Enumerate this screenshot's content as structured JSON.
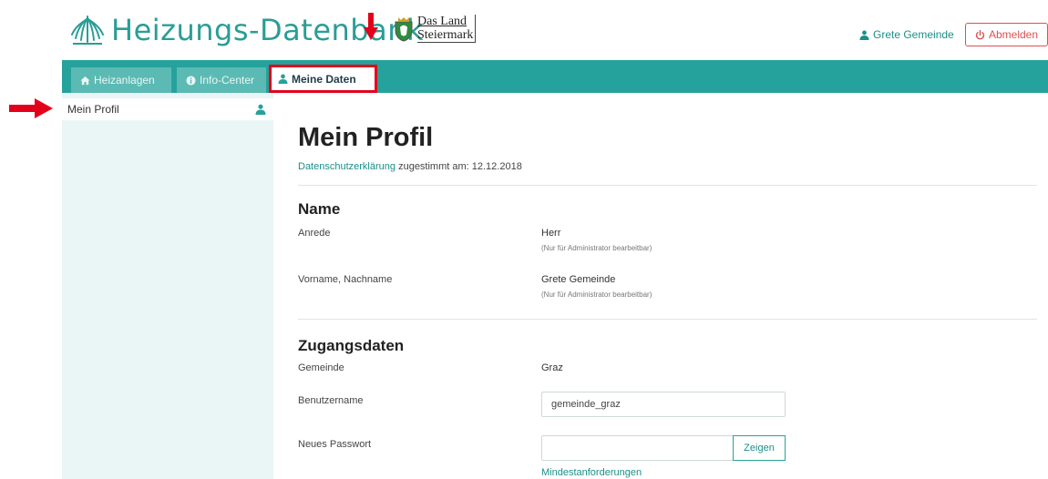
{
  "header": {
    "brand": "Heizungs-Datenbank",
    "partner_line1": "Das Land",
    "partner_line2": "Steiermark",
    "user_name": "Grete Gemeinde",
    "logout_label": "Abmelden"
  },
  "nav": {
    "tabs": [
      {
        "label": "Heizanlagen",
        "icon": "home-icon"
      },
      {
        "label": "Info-Center",
        "icon": "info-icon"
      },
      {
        "label": "Meine Daten",
        "icon": "user-icon",
        "active": true
      }
    ]
  },
  "sidebar": {
    "items": [
      {
        "label": "Mein Profil",
        "icon": "user-icon"
      }
    ]
  },
  "profile": {
    "title": "Mein Profil",
    "privacy_link": "Datenschutzerklärung",
    "privacy_text": "zugestimmt am: 12.12.2018",
    "section_name": "Name",
    "salutation_label": "Anrede",
    "salutation_value": "Herr",
    "salutation_note": "(Nur für Administrator bearbeitbar)",
    "fullname_label": "Vorname, Nachname",
    "fullname_value": "Grete Gemeinde",
    "fullname_note": "(Nur für Administrator bearbeitbar)",
    "section_access": "Zugangsdaten",
    "municipality_label": "Gemeinde",
    "municipality_value": "Graz",
    "username_label": "Benutzername",
    "username_value": "gemeinde_graz",
    "password_label": "Neues Passwort",
    "password_value": "",
    "show_button": "Zeigen",
    "requirements_link": "Mindestanforderungen"
  },
  "colors": {
    "primary": "#25a29b",
    "tab_inactive": "#5cbab4",
    "sidebar_bg": "#eaf6f5",
    "danger": "#d9534f",
    "annotation_red": "#e3001b"
  }
}
